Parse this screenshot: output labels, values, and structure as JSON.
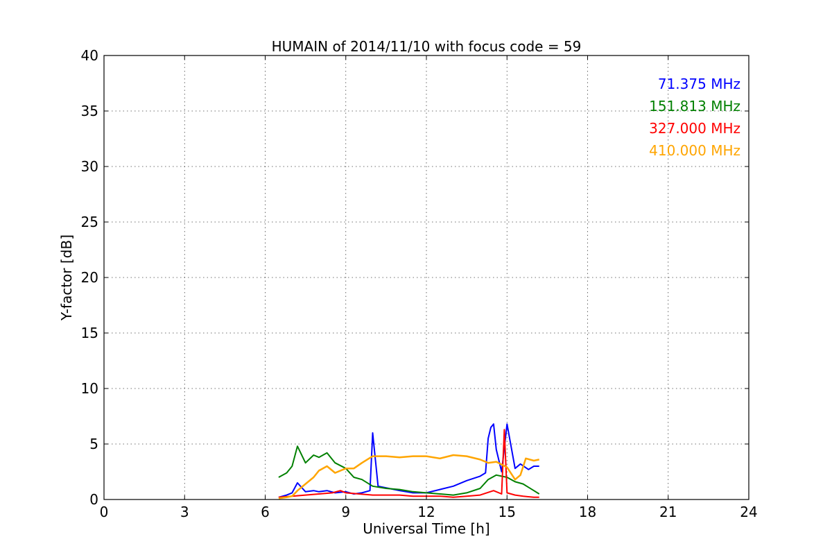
{
  "chart_data": {
    "type": "line",
    "title": "HUMAIN of 2014/11/10 with focus code = 59",
    "xlabel": "Universal Time [h]",
    "ylabel": "Y-factor [dB]",
    "xlim": [
      0,
      24
    ],
    "ylim": [
      0,
      40
    ],
    "xticks": [
      0,
      3,
      6,
      9,
      12,
      15,
      18,
      21,
      24
    ],
    "yticks": [
      0,
      5,
      10,
      15,
      20,
      25,
      30,
      35,
      40
    ],
    "grid": true,
    "legend_placement": "top-right",
    "series": [
      {
        "name": "71.375 MHz",
        "color": "#0000ff",
        "x": [
          6.5,
          6.8,
          7.0,
          7.2,
          7.5,
          7.8,
          8.0,
          8.3,
          8.6,
          9.0,
          9.3,
          9.6,
          9.9,
          10.0,
          10.2,
          10.6,
          11.0,
          11.5,
          12.0,
          12.5,
          13.0,
          13.5,
          14.0,
          14.2,
          14.3,
          14.4,
          14.5,
          14.6,
          14.8,
          15.0,
          15.3,
          15.5,
          15.8,
          16.0,
          16.2
        ],
        "y": [
          0.2,
          0.4,
          0.6,
          1.5,
          0.7,
          0.8,
          0.7,
          0.8,
          0.6,
          0.7,
          0.5,
          0.6,
          0.8,
          6.0,
          1.2,
          1.0,
          0.8,
          0.6,
          0.6,
          0.9,
          1.2,
          1.7,
          2.1,
          2.4,
          5.5,
          6.5,
          6.8,
          4.5,
          2.5,
          6.8,
          2.8,
          3.2,
          2.7,
          3.0,
          3.0
        ]
      },
      {
        "name": "151.813 MHz",
        "color": "#008000",
        "x": [
          6.5,
          6.8,
          7.0,
          7.2,
          7.5,
          7.8,
          8.0,
          8.3,
          8.6,
          9.0,
          9.3,
          9.6,
          10.0,
          10.5,
          11.0,
          11.5,
          12.0,
          12.5,
          13.0,
          13.5,
          14.0,
          14.3,
          14.6,
          15.0,
          15.3,
          15.6,
          16.0,
          16.2
        ],
        "y": [
          2.0,
          2.4,
          3.0,
          4.8,
          3.3,
          4.0,
          3.8,
          4.2,
          3.3,
          2.8,
          2.0,
          1.8,
          1.2,
          1.0,
          0.9,
          0.7,
          0.6,
          0.5,
          0.4,
          0.6,
          1.0,
          1.8,
          2.2,
          2.0,
          1.6,
          1.4,
          0.8,
          0.5
        ]
      },
      {
        "name": "327.000 MHz",
        "color": "#ff0000",
        "x": [
          6.5,
          7.0,
          7.5,
          8.0,
          8.5,
          8.8,
          9.0,
          9.5,
          10.0,
          10.5,
          11.0,
          11.5,
          12.0,
          12.5,
          13.0,
          13.5,
          14.0,
          14.5,
          14.8,
          14.9,
          15.0,
          15.3,
          15.6,
          16.0,
          16.2
        ],
        "y": [
          0.2,
          0.3,
          0.4,
          0.5,
          0.6,
          0.8,
          0.6,
          0.5,
          0.4,
          0.4,
          0.4,
          0.3,
          0.3,
          0.3,
          0.2,
          0.3,
          0.4,
          0.8,
          0.5,
          6.3,
          0.6,
          0.4,
          0.3,
          0.2,
          0.2
        ]
      },
      {
        "name": "410.000 MHz",
        "color": "#ffa500",
        "x": [
          6.5,
          6.8,
          7.0,
          7.2,
          7.5,
          7.8,
          8.0,
          8.3,
          8.6,
          9.0,
          9.3,
          9.6,
          10.0,
          10.5,
          11.0,
          11.5,
          12.0,
          12.5,
          13.0,
          13.5,
          14.0,
          14.3,
          14.6,
          15.0,
          15.3,
          15.5,
          15.7,
          16.0,
          16.2
        ],
        "y": [
          0.1,
          0.2,
          0.3,
          0.8,
          1.4,
          2.0,
          2.6,
          3.0,
          2.4,
          2.8,
          2.8,
          3.3,
          3.9,
          3.9,
          3.8,
          3.9,
          3.9,
          3.7,
          4.0,
          3.9,
          3.6,
          3.3,
          3.4,
          2.9,
          1.8,
          2.2,
          3.7,
          3.5,
          3.6
        ]
      }
    ]
  }
}
